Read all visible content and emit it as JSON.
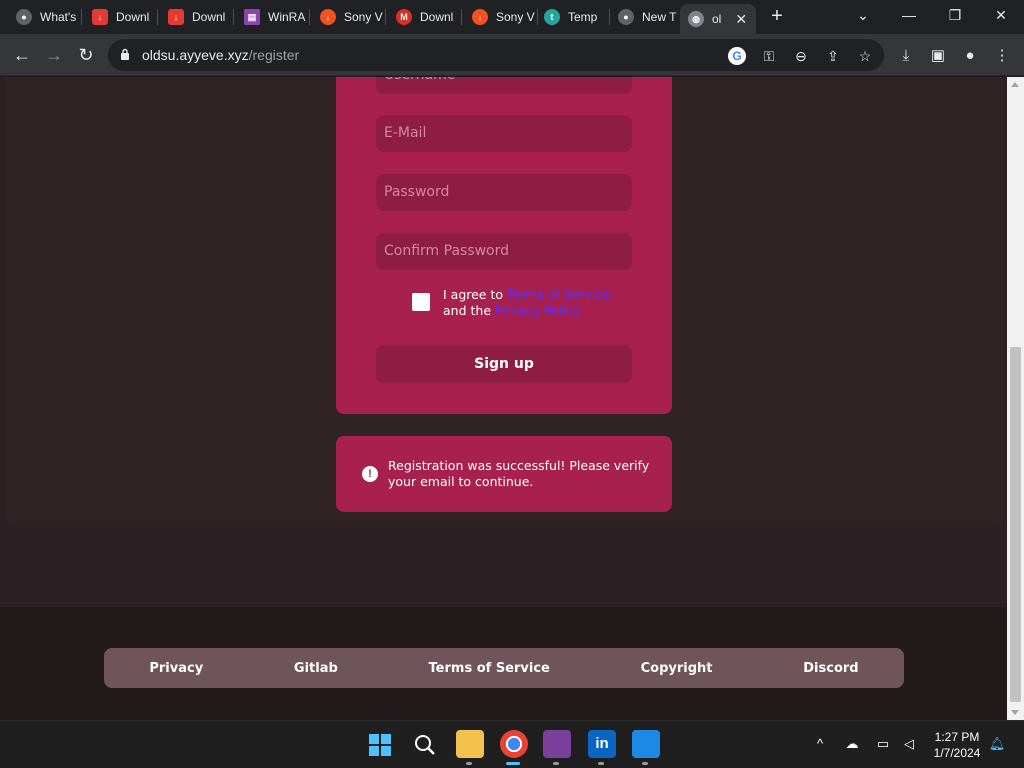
{
  "browser": {
    "tabs": [
      {
        "label": "What's",
        "icon": "chrome-icon",
        "color": "#5f6368"
      },
      {
        "label": "Downl",
        "icon": "download-icon",
        "color": "#e53935"
      },
      {
        "label": "Downl",
        "icon": "download-icon",
        "color": "#e53935"
      },
      {
        "label": "WinRA",
        "icon": "winrar-icon",
        "color": "#8e44ad"
      },
      {
        "label": "Sony V",
        "icon": "download-icon",
        "color": "#f4511e"
      },
      {
        "label": "Downl",
        "icon": "gmail-icon",
        "color": "#d93025"
      },
      {
        "label": "Sony V",
        "icon": "download-icon",
        "color": "#f4511e"
      },
      {
        "label": "Temp",
        "icon": "temp-icon",
        "color": "#26a69a"
      },
      {
        "label": "New T",
        "icon": "chrome-icon",
        "color": "#5f6368"
      }
    ],
    "active_tab": {
      "label": "ol",
      "icon": "globe-icon"
    },
    "url_host": "oldsu.ayyeve.xyz",
    "url_path": "/register"
  },
  "form": {
    "username_placeholder": "Username",
    "email_placeholder": "E-Mail",
    "password_placeholder": "Password",
    "confirm_placeholder": "Confirm Password",
    "agree_prefix": "I agree to ",
    "terms_link": "Terms of Service",
    "agree_mid": "and the ",
    "privacy_link": "Privacy Policy",
    "signup_label": "Sign up"
  },
  "alert": {
    "message": "Registration was successful! Please verify your email to continue."
  },
  "footer": {
    "links": [
      "Privacy",
      "Gitlab",
      "Terms of Service",
      "Copyright",
      "Discord"
    ]
  },
  "taskbar": {
    "time": "1:27 PM",
    "date": "1/7/2024"
  },
  "colors": {
    "accent": "#a8214e",
    "field": "#8f1c42",
    "link": "#5b2bff",
    "footer_bar": "#6f5559"
  }
}
